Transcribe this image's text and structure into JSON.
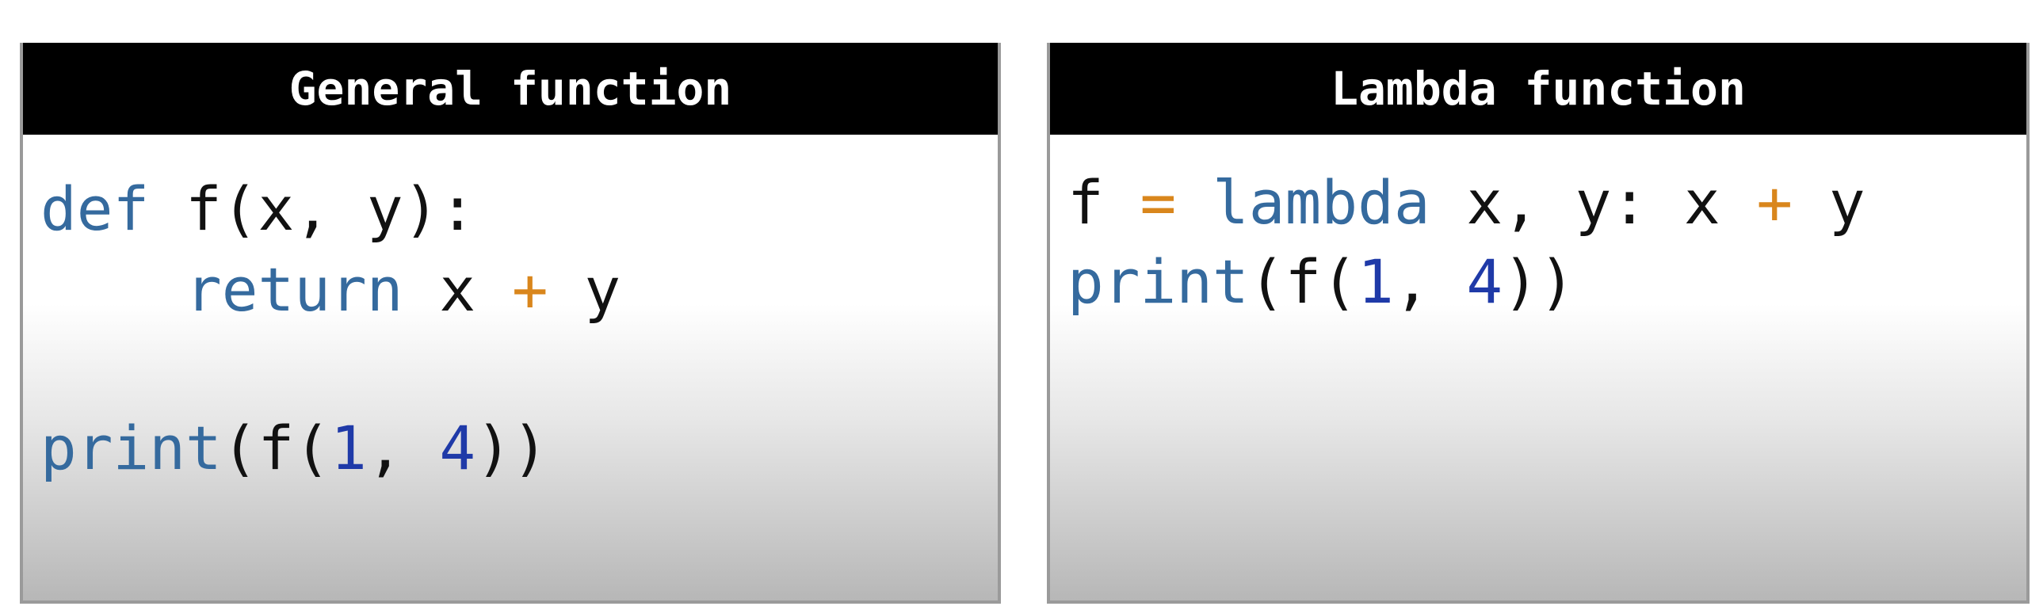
{
  "panels": {
    "general": {
      "title": "General function",
      "line1": {
        "kw": "def",
        "rest": " f(x, y):"
      },
      "line2": {
        "indent": "    ",
        "kw": "return",
        "a": " x ",
        "op": "+",
        "b": " y"
      },
      "line3": {
        "kw": "print",
        "open": "(f(",
        "n1": "1",
        "sep": ", ",
        "n2": "4",
        "close": "))"
      }
    },
    "lambda": {
      "title": "Lambda function",
      "line1": {
        "a": "f ",
        "eq": "=",
        "sp": " ",
        "kw": "lambda",
        "b": " x, y: x ",
        "op": "+",
        "c": " y"
      },
      "line2": {
        "kw": "print",
        "open": "(f(",
        "n1": "1",
        "sep": ", ",
        "n2": "4",
        "close": "))"
      }
    }
  },
  "colors": {
    "keyword": "#356a9e",
    "operator": "#d9861c",
    "number": "#1f3aa8",
    "text": "#111111",
    "header_bg": "#000000",
    "header_text": "#ffffff"
  }
}
